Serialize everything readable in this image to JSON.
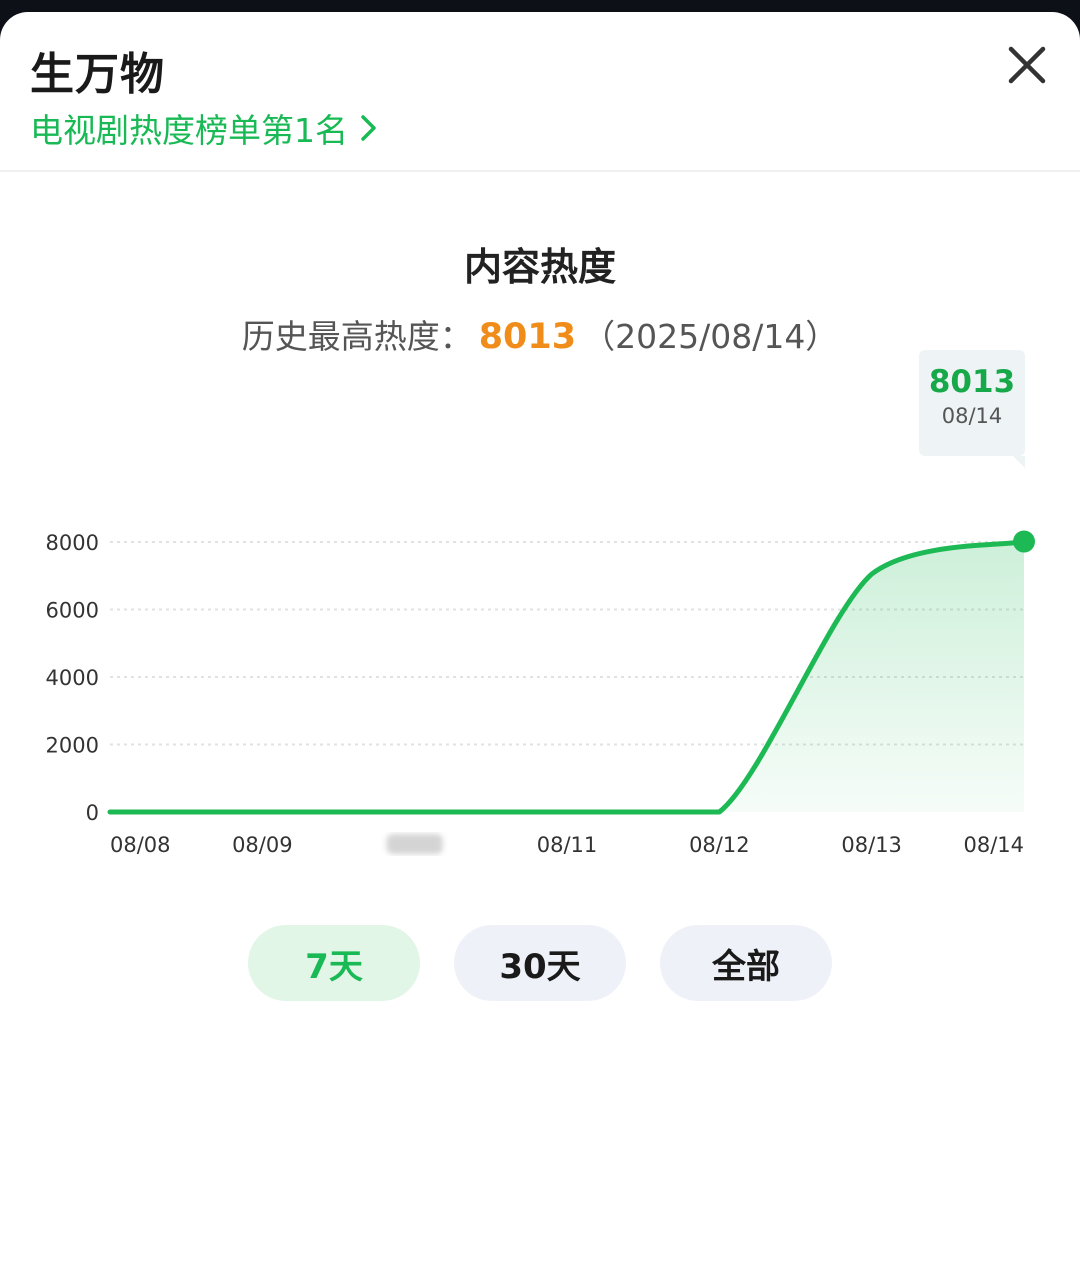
{
  "header": {
    "title": "生万物",
    "rank_text": "电视剧热度榜单第1名"
  },
  "section": {
    "title": "内容热度",
    "history_label": "历史最高热度：",
    "history_peak": "8013",
    "history_date": "（2025/08/14）"
  },
  "tooltip": {
    "value": "8013",
    "date": "08/14"
  },
  "chart_data": {
    "type": "area",
    "x": [
      "08/08",
      "08/09",
      "08/10",
      "08/11",
      "08/12",
      "08/13",
      "08/14"
    ],
    "x_labels": [
      "08/08",
      "08/09",
      "",
      "08/11",
      "08/12",
      "08/13",
      "08/14"
    ],
    "values": [
      0,
      0,
      0,
      0,
      0,
      7050,
      8013
    ],
    "y_ticks": [
      "0",
      "2000",
      "4000",
      "6000",
      "8000"
    ],
    "ylim": [
      0,
      8000
    ],
    "grid": true,
    "color": "#1db954"
  },
  "range": {
    "buttons": [
      "7天",
      "30天",
      "全部"
    ],
    "active_index": 0
  },
  "colors": {
    "accent": "#19b955",
    "peak": "#f08c1a"
  }
}
